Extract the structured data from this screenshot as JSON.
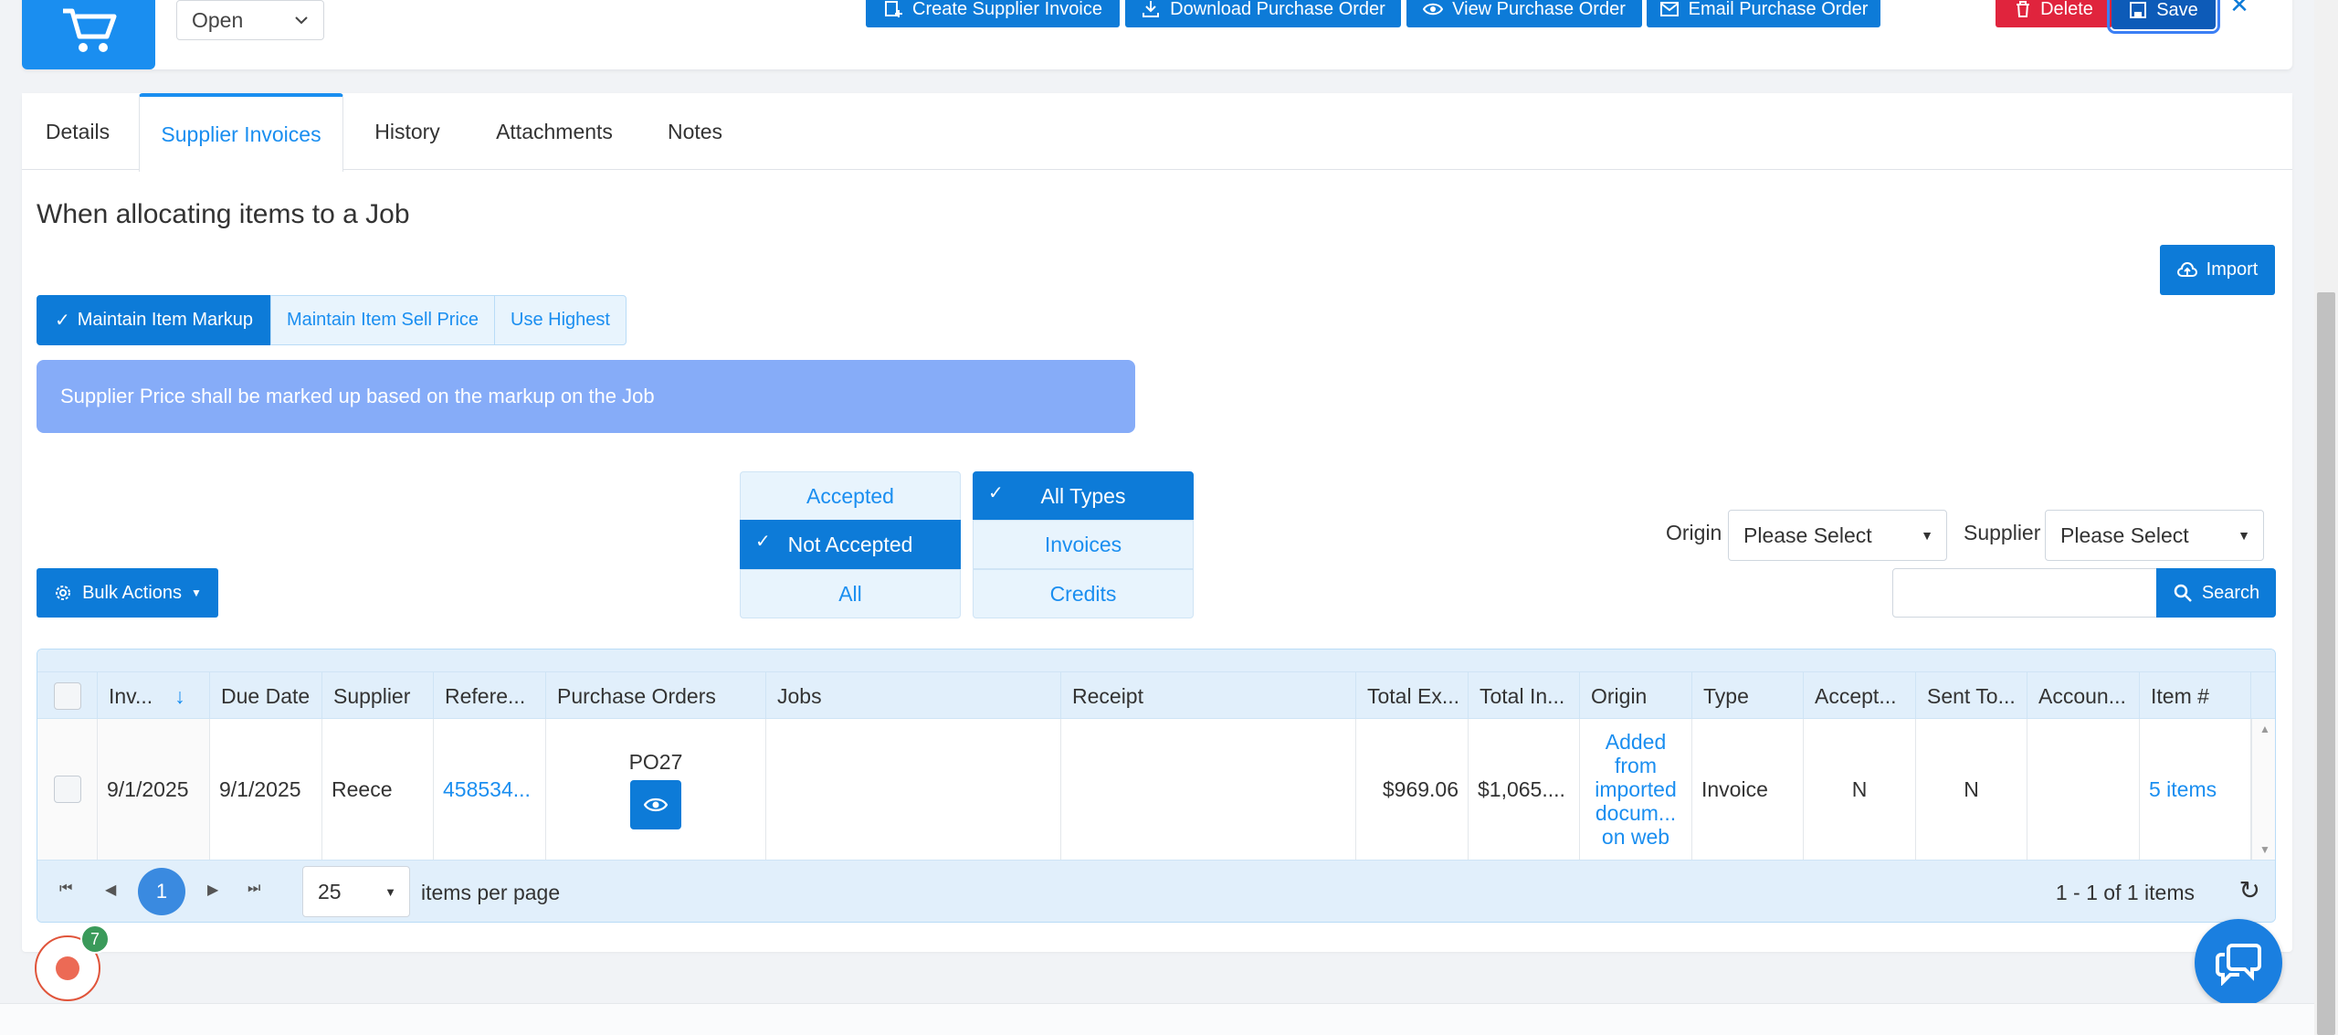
{
  "header": {
    "status_value": "Open",
    "buttons": {
      "create_supplier_invoice": "Create Supplier Invoice",
      "download_purchase_order": "Download Purchase Order",
      "view_purchase_order": "View Purchase Order",
      "email_purchase_order": "Email Purchase Order",
      "delete": "Delete",
      "save": "Save"
    }
  },
  "tabs": [
    {
      "label": "Details"
    },
    {
      "label": "Supplier Invoices",
      "active": true
    },
    {
      "label": "History"
    },
    {
      "label": "Attachments"
    },
    {
      "label": "Notes"
    }
  ],
  "allocation": {
    "title": "When allocating items to a Job",
    "options": [
      "Maintain Item Markup",
      "Maintain Item Sell Price",
      "Use Highest"
    ],
    "selected": "Maintain Item Markup",
    "info": "Supplier Price shall be marked up based on the markup on the Job"
  },
  "import_label": "Import",
  "acceptance_filter": {
    "options": [
      "Accepted",
      "Not Accepted",
      "All"
    ],
    "selected": "Not Accepted"
  },
  "type_filter": {
    "options": [
      "All Types",
      "Invoices",
      "Credits"
    ],
    "selected": "All Types"
  },
  "origin": {
    "label": "Origin",
    "value": "Please Select"
  },
  "supplier": {
    "label": "Supplier",
    "value": "Please Select"
  },
  "bulk_actions_label": "Bulk Actions",
  "search": {
    "placeholder": "",
    "button": "Search"
  },
  "grid": {
    "columns": [
      "Inv...",
      "Due Date",
      "Supplier",
      "Refere...",
      "Purchase Orders",
      "Jobs",
      "Receipt",
      "Total Ex...",
      "Total In...",
      "Origin",
      "Type",
      "Accept...",
      "Sent To...",
      "Accoun...",
      "Item #"
    ],
    "rows": [
      {
        "invoice_date": "9/1/2025",
        "due_date": "9/1/2025",
        "supplier": "Reece",
        "reference": "458534...",
        "purchase_order": "PO27",
        "jobs": "",
        "receipt": "",
        "total_ex": "$969.06",
        "total_inc": "$1,065....",
        "origin": "Added from imported docum... on web",
        "type": "Invoice",
        "accepted": "N",
        "sent_to": "N",
        "account": "",
        "items": "5 items"
      }
    ],
    "pager": {
      "current_page": "1",
      "page_size": "25",
      "per_page_label": "items per page",
      "summary": "1 - 1 of 1 items"
    }
  },
  "notification_count": "7",
  "colors": {
    "primary": "#0d7bd8",
    "tab_active": "#1a8ef0",
    "delete": "#e0243d",
    "info_bar": "#86acf8"
  }
}
